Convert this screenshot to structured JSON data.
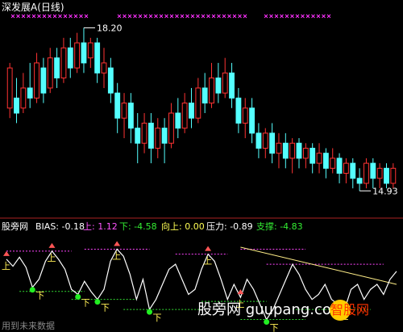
{
  "chart_data": [
    {
      "type": "candlestick",
      "title": "深发展A(日线)",
      "max_label": "18.20",
      "min_label": "14.93",
      "ylim": [
        14.6,
        18.4
      ],
      "series": [
        {
          "o": 16.6,
          "c": 17.4,
          "h": 17.5,
          "l": 16.4
        },
        {
          "o": 16.8,
          "c": 16.5,
          "h": 17.2,
          "l": 16.3
        },
        {
          "o": 16.6,
          "c": 17.0,
          "h": 17.3,
          "l": 16.5
        },
        {
          "o": 17.0,
          "c": 16.8,
          "h": 17.5,
          "l": 16.6
        },
        {
          "o": 16.8,
          "c": 17.5,
          "h": 17.7,
          "l": 16.7
        },
        {
          "o": 17.4,
          "c": 16.9,
          "h": 17.6,
          "l": 16.7
        },
        {
          "o": 17.0,
          "c": 17.6,
          "h": 17.8,
          "l": 16.9
        },
        {
          "o": 17.6,
          "c": 17.2,
          "h": 17.8,
          "l": 17.0
        },
        {
          "o": 17.2,
          "c": 17.8,
          "h": 18.0,
          "l": 17.1
        },
        {
          "o": 17.8,
          "c": 17.4,
          "h": 18.0,
          "l": 17.2
        },
        {
          "o": 17.4,
          "c": 17.9,
          "h": 18.1,
          "l": 17.3
        },
        {
          "o": 17.9,
          "c": 17.5,
          "h": 18.2,
          "l": 17.3
        },
        {
          "o": 17.6,
          "c": 17.9,
          "h": 18.0,
          "l": 17.4
        },
        {
          "o": 17.9,
          "c": 17.3,
          "h": 18.0,
          "l": 17.1
        },
        {
          "o": 17.3,
          "c": 17.5,
          "h": 17.8,
          "l": 17.0
        },
        {
          "o": 17.4,
          "c": 16.9,
          "h": 17.6,
          "l": 16.7
        },
        {
          "o": 16.9,
          "c": 16.4,
          "h": 17.1,
          "l": 16.1
        },
        {
          "o": 16.4,
          "c": 16.7,
          "h": 16.9,
          "l": 16.0
        },
        {
          "o": 16.7,
          "c": 16.2,
          "h": 16.9,
          "l": 15.9
        },
        {
          "o": 16.2,
          "c": 15.9,
          "h": 16.5,
          "l": 15.5
        },
        {
          "o": 15.9,
          "c": 16.3,
          "h": 16.5,
          "l": 15.7
        },
        {
          "o": 16.3,
          "c": 15.8,
          "h": 16.5,
          "l": 15.5
        },
        {
          "o": 15.8,
          "c": 16.2,
          "h": 16.4,
          "l": 15.6
        },
        {
          "o": 16.2,
          "c": 15.9,
          "h": 16.4,
          "l": 15.5
        },
        {
          "o": 15.9,
          "c": 16.5,
          "h": 16.7,
          "l": 15.8
        },
        {
          "o": 16.5,
          "c": 16.2,
          "h": 16.8,
          "l": 16.0
        },
        {
          "o": 16.2,
          "c": 16.7,
          "h": 16.9,
          "l": 16.1
        },
        {
          "o": 16.7,
          "c": 16.4,
          "h": 17.0,
          "l": 16.2
        },
        {
          "o": 16.4,
          "c": 17.0,
          "h": 17.2,
          "l": 16.3
        },
        {
          "o": 17.0,
          "c": 16.7,
          "h": 17.3,
          "l": 16.5
        },
        {
          "o": 16.7,
          "c": 17.2,
          "h": 17.5,
          "l": 16.6
        },
        {
          "o": 17.2,
          "c": 16.9,
          "h": 17.5,
          "l": 16.7
        },
        {
          "o": 16.9,
          "c": 17.3,
          "h": 17.6,
          "l": 16.8
        },
        {
          "o": 17.3,
          "c": 16.8,
          "h": 17.5,
          "l": 16.6
        },
        {
          "o": 16.8,
          "c": 16.3,
          "h": 17.0,
          "l": 16.1
        },
        {
          "o": 16.3,
          "c": 16.6,
          "h": 16.8,
          "l": 16.0
        },
        {
          "o": 16.6,
          "c": 16.1,
          "h": 16.8,
          "l": 15.9
        },
        {
          "o": 16.1,
          "c": 15.8,
          "h": 16.3,
          "l": 15.6
        },
        {
          "o": 15.8,
          "c": 16.1,
          "h": 16.2,
          "l": 15.6
        },
        {
          "o": 16.1,
          "c": 15.7,
          "h": 16.3,
          "l": 15.5
        },
        {
          "o": 15.7,
          "c": 15.9,
          "h": 16.1,
          "l": 15.4
        },
        {
          "o": 15.9,
          "c": 15.6,
          "h": 16.1,
          "l": 15.4
        },
        {
          "o": 15.6,
          "c": 15.9,
          "h": 16.0,
          "l": 15.3
        },
        {
          "o": 15.9,
          "c": 15.6,
          "h": 16.0,
          "l": 15.4
        },
        {
          "o": 15.6,
          "c": 15.8,
          "h": 15.9,
          "l": 15.4
        },
        {
          "o": 15.8,
          "c": 15.5,
          "h": 15.9,
          "l": 15.3
        },
        {
          "o": 15.5,
          "c": 15.7,
          "h": 15.9,
          "l": 15.3
        },
        {
          "o": 15.7,
          "c": 15.4,
          "h": 15.8,
          "l": 15.2
        },
        {
          "o": 15.4,
          "c": 15.6,
          "h": 15.8,
          "l": 15.3
        },
        {
          "o": 15.6,
          "c": 15.3,
          "h": 15.7,
          "l": 15.1
        },
        {
          "o": 15.3,
          "c": 15.5,
          "h": 15.6,
          "l": 15.1
        },
        {
          "o": 15.5,
          "c": 15.2,
          "h": 15.6,
          "l": 15.0
        },
        {
          "o": 15.2,
          "c": 15.1,
          "h": 15.4,
          "l": 14.95
        },
        {
          "o": 15.1,
          "c": 15.5,
          "h": 15.6,
          "l": 15.0
        },
        {
          "o": 15.5,
          "c": 15.2,
          "h": 15.6,
          "l": 15.0
        },
        {
          "o": 15.2,
          "c": 15.4,
          "h": 15.5,
          "l": 15.0
        },
        {
          "o": 15.4,
          "c": 15.1,
          "h": 15.5,
          "l": 15.0
        },
        {
          "o": 15.1,
          "c": 15.4,
          "h": 15.5,
          "l": 15.0
        }
      ]
    },
    {
      "type": "line",
      "header": {
        "site": "股旁网",
        "bias_label": "BIAS: -0.18",
        "up_label": "上: 1.12",
        "down_label": "下: -4.58",
        "xiangshang_label": "向上: 0.00",
        "yali_label": "压力: -0.89",
        "zhicheng_label": "支撑: -4.83"
      },
      "ylim": [
        -6,
        3
      ],
      "series": [
        {
          "name": "BIAS",
          "values": [
            1.0,
            0.3,
            1.2,
            0.2,
            -1.8,
            -1.0,
            0.8,
            1.8,
            1.0,
            0.0,
            -2.0,
            -2.5,
            -1.2,
            -2.2,
            -3.0,
            -2.0,
            0.8,
            2.0,
            1.3,
            -0.5,
            -3.0,
            -1.0,
            -4.0,
            -3.0,
            -1.5,
            0.0,
            0.5,
            -1.0,
            -2.5,
            -2.0,
            0.0,
            1.5,
            0.8,
            -1.0,
            -3.0,
            -1.5,
            -2.8,
            -1.0,
            -2.0,
            -3.5,
            -5.0,
            -4.0,
            -2.5,
            -1.0,
            0.5,
            -0.5,
            -2.0,
            -3.0,
            -2.5,
            -1.5,
            -3.0,
            -3.5,
            -4.0,
            -2.0,
            -1.5,
            -3.0,
            -2.0,
            -1.5,
            -2.5,
            -1.0,
            -0.2
          ]
        }
      ],
      "marker_labels": {
        "up": "上",
        "down": "下"
      }
    }
  ],
  "watermark": {
    "text": "股旁网 guupang.com",
    "logo": "智股网",
    "footer": "用到未来数据"
  },
  "colors": {
    "up": "#ff3333",
    "down": "#54ffff",
    "bias": "#ffffff",
    "resistance": "#ff44ff",
    "support": "#33dd33",
    "trend": "#ffee88",
    "marker_up": "#ff5555",
    "marker_down": "#22ee22"
  }
}
